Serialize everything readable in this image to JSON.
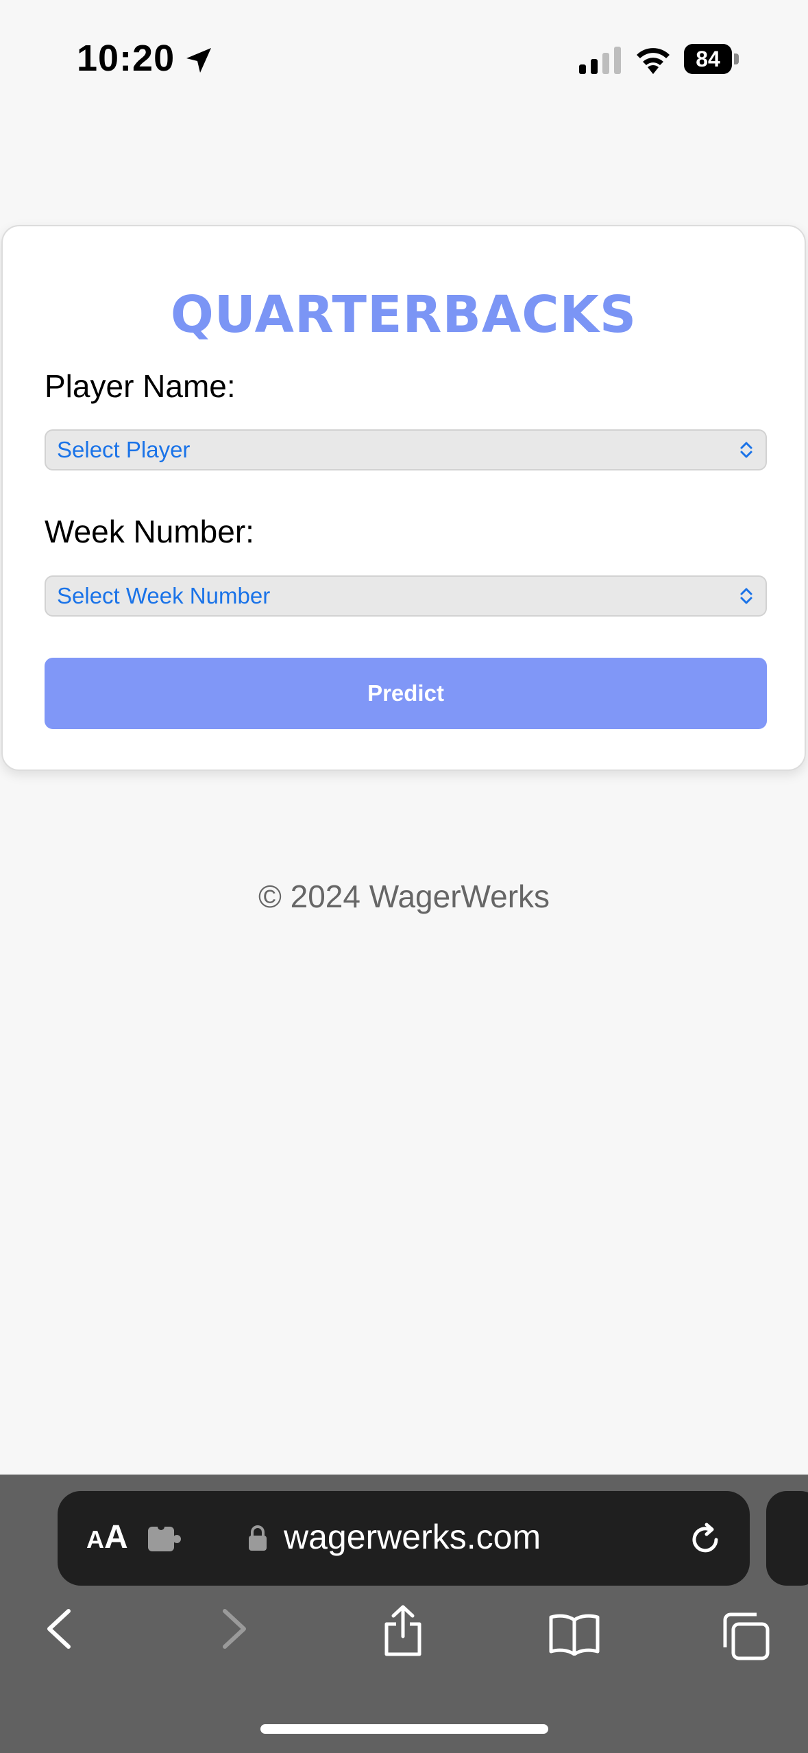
{
  "status_bar": {
    "time": "10:20",
    "battery": "84"
  },
  "card": {
    "title": "QUARTERBACKS",
    "player_label": "Player Name:",
    "player_select": "Select Player",
    "week_label": "Week Number:",
    "week_select": "Select Week Number",
    "predict_label": "Predict"
  },
  "footer": "© 2024 WagerWerks",
  "browser": {
    "aa_small": "A",
    "aa_big": "A",
    "url": "wagerwerks.com"
  },
  "colors": {
    "accent": "#7b95f5",
    "button": "#8097f7",
    "select_text": "#1a73e8",
    "page_bg": "#f7f7f7",
    "chrome_bg": "#616161"
  }
}
